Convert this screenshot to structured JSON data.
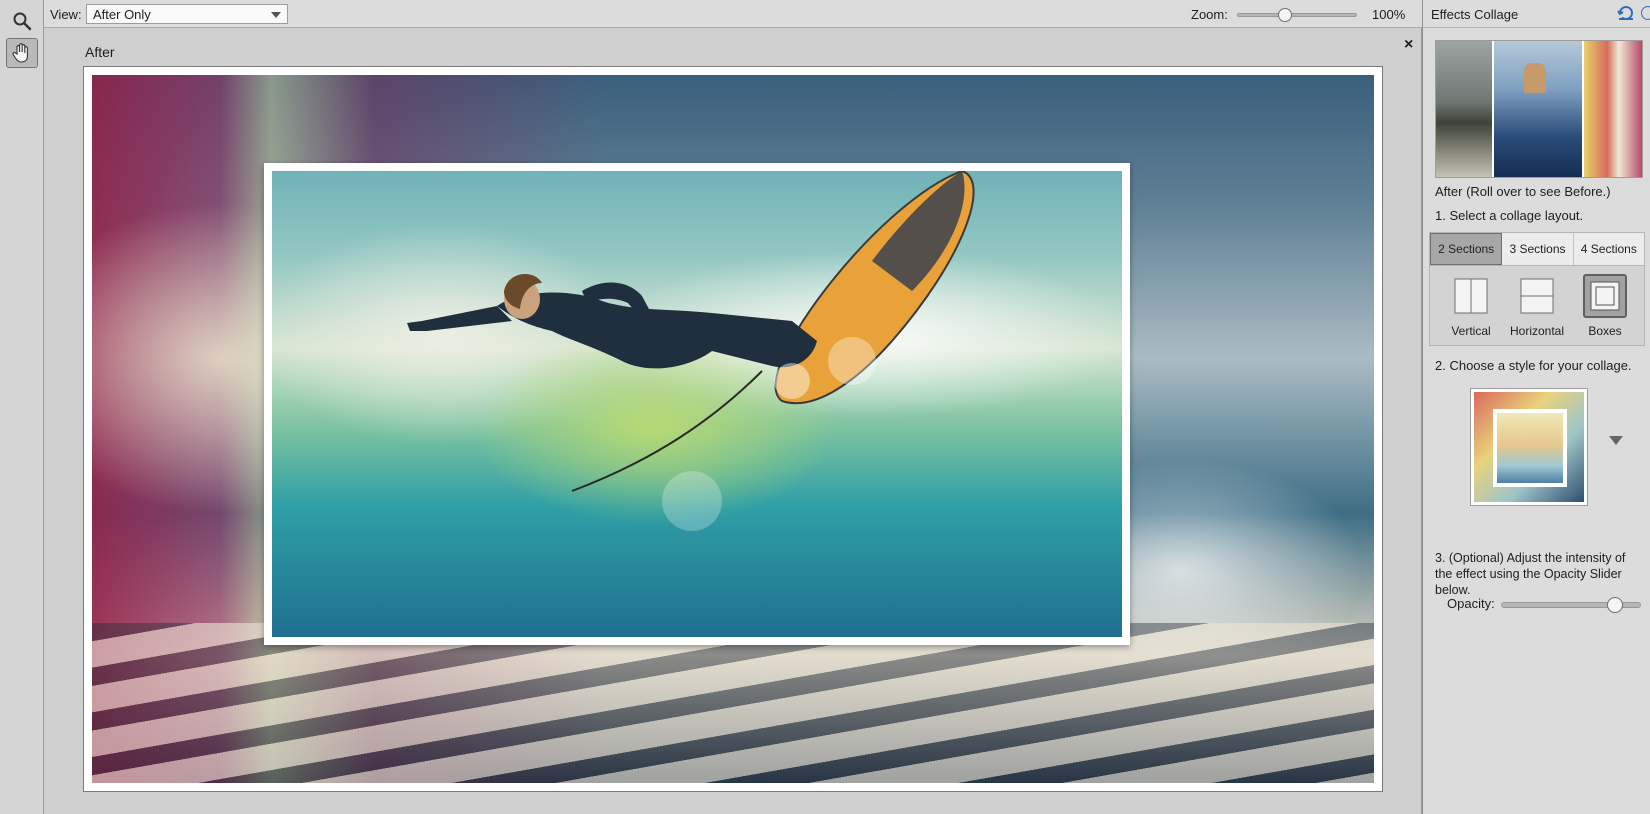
{
  "toolbar": {
    "view_label": "View:",
    "view_selected": "After Only",
    "zoom_label": "Zoom:",
    "zoom_value": "100%",
    "zoom_level": 0.4
  },
  "tools": {
    "zoom_tool": "zoom-icon",
    "hand_tool": "hand-icon"
  },
  "canvas": {
    "view_title": "After",
    "close_symbol": "×"
  },
  "panel": {
    "title": "Effects Collage",
    "preview_caption": "After (Roll over to see Before.)",
    "step1": "1. Select a collage layout.",
    "tabs": [
      "2 Sections",
      "3 Sections",
      "4 Sections"
    ],
    "active_tab": 0,
    "layouts": [
      "Vertical",
      "Horizontal",
      "Boxes"
    ],
    "active_layout": 2,
    "step2": "2. Choose a style for your collage.",
    "step3": "3. (Optional) Adjust the intensity of the effect using the Opacity Slider below.",
    "opacity_label": "Opacity:",
    "opacity_level": 0.82
  },
  "colors": {
    "accent_blue": "#2a6fb6",
    "panel_bg": "#dcdcdc",
    "canvas_bg": "#cfcfcf"
  }
}
